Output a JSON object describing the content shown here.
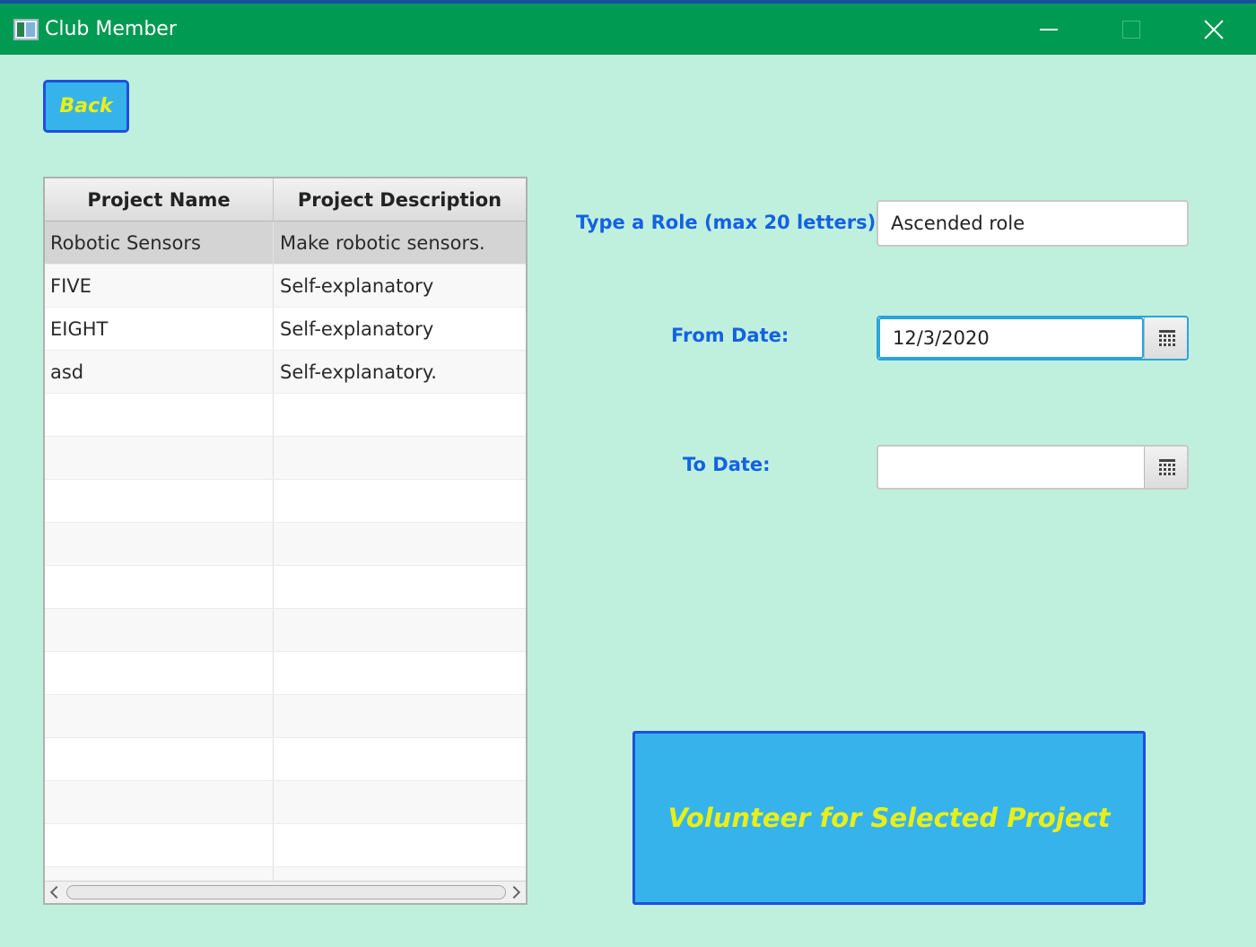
{
  "window": {
    "title": "Club Member",
    "icons": {
      "app": "app-window-icon",
      "minimize": "minimize-icon",
      "maximize": "maximize-icon",
      "close": "close-icon"
    }
  },
  "back_button": {
    "label": "Back"
  },
  "table": {
    "columns": [
      "Project Name",
      "Project Description"
    ],
    "selected_row": 0,
    "rows": [
      {
        "name": "Robotic Sensors",
        "description": "Make robotic sensors."
      },
      {
        "name": "FIVE",
        "description": "Self-explanatory"
      },
      {
        "name": "EIGHT",
        "description": "Self-explanatory"
      },
      {
        "name": "asd",
        "description": "Self-explanatory."
      },
      {
        "name": "",
        "description": ""
      },
      {
        "name": "",
        "description": ""
      },
      {
        "name": "",
        "description": ""
      },
      {
        "name": "",
        "description": ""
      },
      {
        "name": "",
        "description": ""
      },
      {
        "name": "",
        "description": ""
      },
      {
        "name": "",
        "description": ""
      },
      {
        "name": "",
        "description": ""
      },
      {
        "name": "",
        "description": ""
      },
      {
        "name": "",
        "description": ""
      },
      {
        "name": "",
        "description": ""
      },
      {
        "name": "",
        "description": ""
      }
    ]
  },
  "form": {
    "role_label": "Type a Role (max 20 letters):",
    "role_value": "Ascended role",
    "from_label": "From Date:",
    "from_value": "12/3/2020",
    "to_label": "To Date:",
    "to_value": ""
  },
  "volunteer_button": {
    "label": "Volunteer for Selected Project"
  },
  "colors": {
    "background": "#bff0dd",
    "titlebar": "#009a52",
    "button_fill": "#36b3ea",
    "button_border": "#1f4fe0",
    "button_text": "#e8ef18",
    "label_text": "#1561e3"
  }
}
